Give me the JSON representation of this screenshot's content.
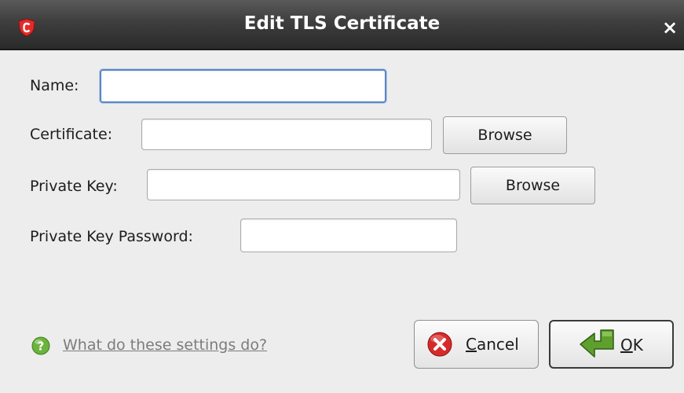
{
  "window": {
    "title": "Edit TLS Certificate",
    "app_icon": "comodo-shield-icon",
    "close_glyph": "×"
  },
  "form": {
    "name": {
      "label": "Name:",
      "value": "",
      "focused": true
    },
    "certificate": {
      "label": "Certificate:",
      "value": "",
      "browse_label": "Browse"
    },
    "private_key": {
      "label": "Private Key:",
      "value": "",
      "browse_label": "Browse"
    },
    "private_key_password": {
      "label": "Private Key Password:",
      "value": ""
    }
  },
  "footer": {
    "help_icon": "help-question-icon",
    "help_link": "What do these settings do?",
    "cancel": {
      "mnemonic": "C",
      "rest": "ancel",
      "icon": "cancel-x-icon"
    },
    "ok": {
      "mnemonic": "O",
      "rest": "K",
      "icon": "green-return-arrow-icon"
    }
  },
  "colors": {
    "titlebar": "#3e3e3e",
    "dialog_bg": "#ededed",
    "focus_ring": "#5b86c6",
    "cancel_red": "#d62a2a",
    "ok_green": "#5e9f2e",
    "help_green": "#6bb33c"
  }
}
